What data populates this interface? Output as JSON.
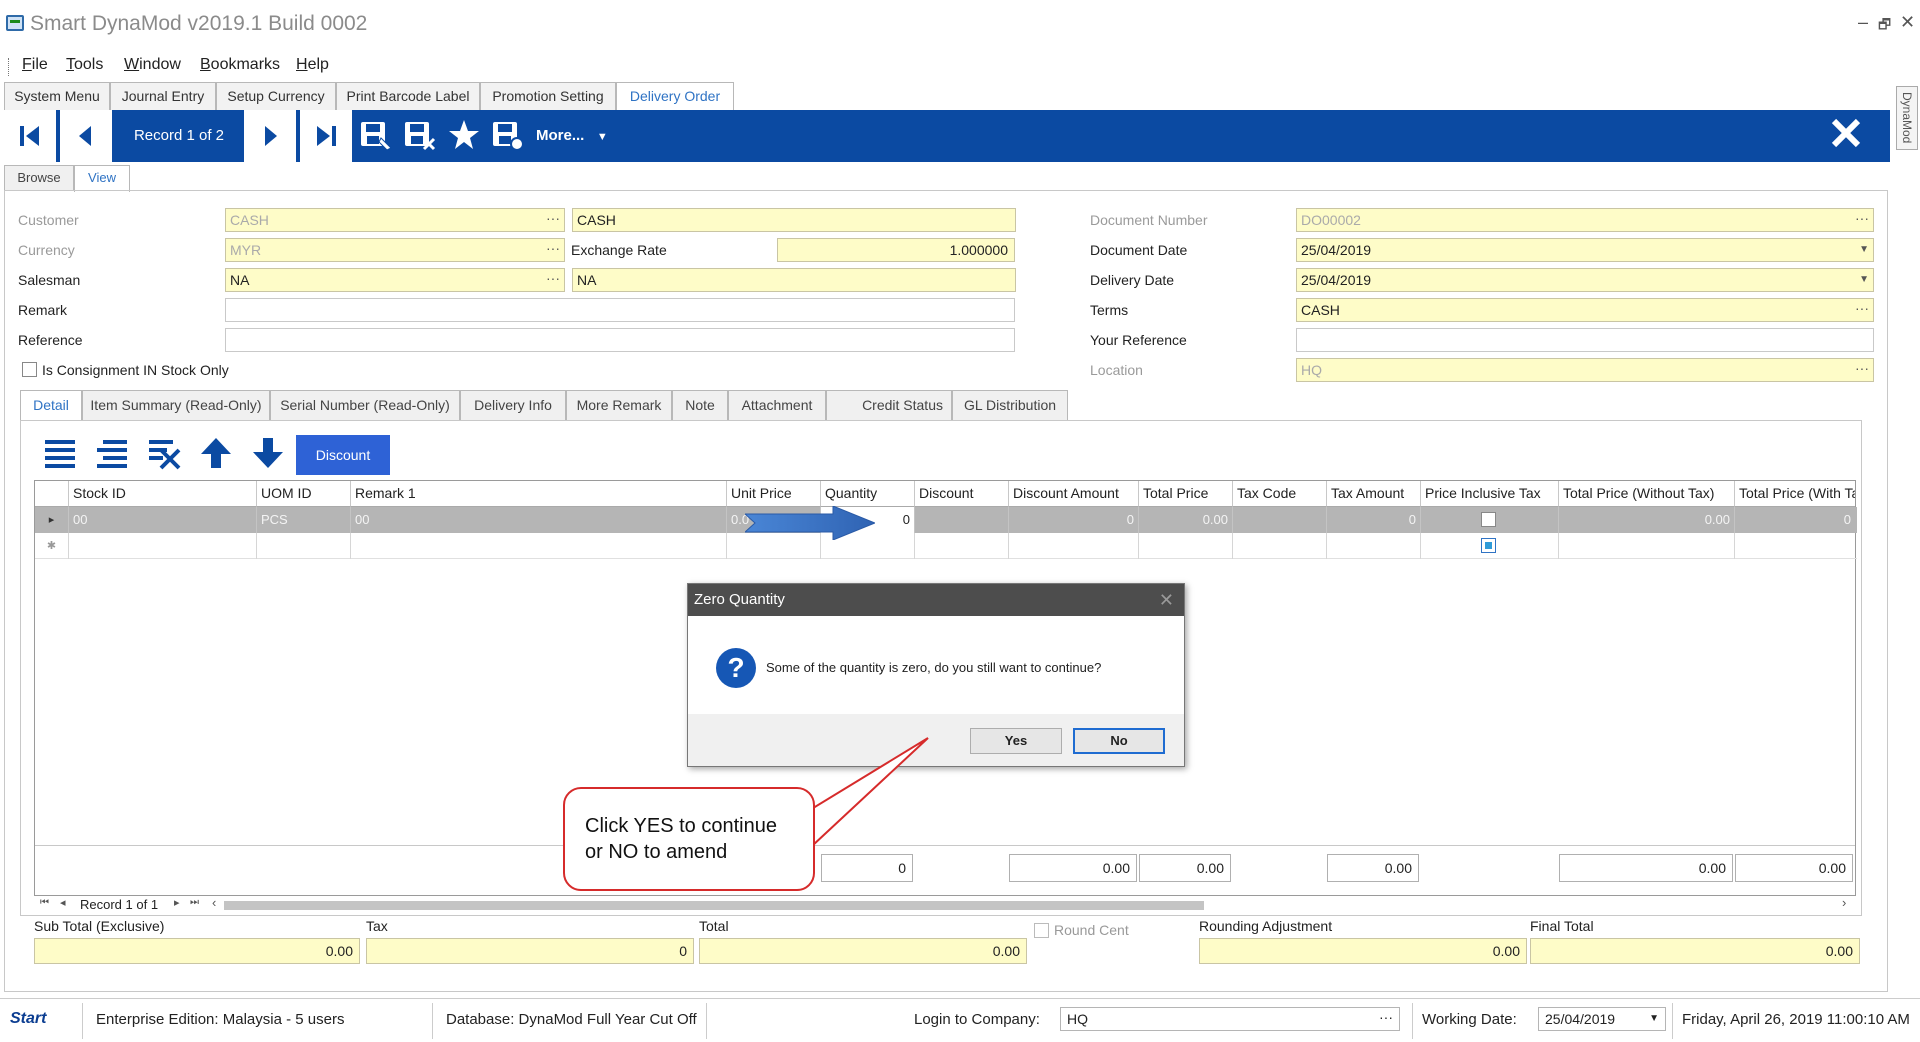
{
  "window": {
    "title": "Smart DynaMod v2019.1 Build 0002",
    "controls": [
      "–",
      "🗗",
      "✕"
    ]
  },
  "menu": [
    {
      "underline": "F",
      "rest": "ile"
    },
    {
      "underline": "T",
      "rest": "ools"
    },
    {
      "underline": "W",
      "rest": "indow"
    },
    {
      "underline": "B",
      "rest": "ookmarks"
    },
    {
      "underline": "H",
      "rest": "elp"
    }
  ],
  "top_tabs": [
    "System Menu",
    "Journal Entry",
    "Setup Currency",
    "Print Barcode Label",
    "Promotion Setting",
    "Delivery Order"
  ],
  "side_tab": "DynaMod",
  "toolbar": {
    "record": "Record 1 of 2",
    "more": "More...",
    "more_caret": "▼"
  },
  "view_tabs": [
    "Browse",
    "View"
  ],
  "form": {
    "customer_label": "Customer",
    "customer_code": "CASH",
    "customer_name": "CASH",
    "currency_label": "Currency",
    "currency_code": "MYR",
    "exchange_rate_label": "Exchange Rate",
    "exchange_rate": "1.000000",
    "salesman_label": "Salesman",
    "salesman_code": "NA",
    "salesman_name": "NA",
    "remark_label": "Remark",
    "remark": "",
    "reference_label": "Reference",
    "reference": "",
    "consignment_label": "Is Consignment IN Stock Only",
    "document_number_label": "Document Number",
    "document_number": "DO00002",
    "document_date_label": "Document Date",
    "document_date": "25/04/2019",
    "delivery_date_label": "Delivery Date",
    "delivery_date": "25/04/2019",
    "terms_label": "Terms",
    "terms": "CASH",
    "your_reference_label": "Your Reference",
    "your_reference": "",
    "location_label": "Location",
    "location": "HQ",
    "dots": "···"
  },
  "detail_tabs": [
    "Detail",
    "Item Summary (Read-Only)",
    "Serial Number (Read-Only)",
    "Delivery Info",
    "More Remark",
    "Note",
    "Attachment",
    "Credit Status",
    "GL Distribution"
  ],
  "detail_toolbar": {
    "discount": "Discount"
  },
  "grid": {
    "columns": [
      "Stock ID",
      "UOM ID",
      "Remark 1",
      "Unit Price",
      "Quantity",
      "Discount",
      "Discount Amount",
      "Total Price",
      "Tax Code",
      "Tax Amount",
      "Price Inclusive Tax",
      "Total Price (Without Tax)",
      "Total Price (With Tax"
    ],
    "row": {
      "indicator": "▸",
      "stock_id": "00",
      "uom": "PCS",
      "remark": "00",
      "unit_price": "0.0",
      "quantity": "0",
      "discount_amount": "0",
      "total_price": "0.00",
      "tax_amount": "0",
      "total_without_tax": "0.00",
      "total_with_tax": "0"
    },
    "new_row_indicator": "✱",
    "totals": {
      "quantity": "0",
      "discount_amount": "0.00",
      "total_price": "0.00",
      "tax_amount": "0.00",
      "total_without_tax": "0.00",
      "total_with_tax": "0.00"
    },
    "navigator": "Record 1 of 1",
    "nav_first": "⏮",
    "nav_prev": "◂",
    "nav_next": "▸",
    "nav_last": "⏭",
    "scroll_left": "‹",
    "scroll_right": "›"
  },
  "bottom_totals": {
    "subtotal_label": "Sub Total (Exclusive)",
    "subtotal": "0.00",
    "tax_label": "Tax",
    "tax": "0",
    "total_label": "Total",
    "total": "0.00",
    "round_cent_label": "Round Cent",
    "rounding_label": "Rounding Adjustment",
    "rounding": "0.00",
    "final_label": "Final Total",
    "final": "0.00"
  },
  "status": {
    "logo": "Start",
    "edition": "Enterprise Edition: Malaysia - 5 users",
    "database": "Database: DynaMod Full Year Cut Off",
    "login_label": "Login to Company:",
    "company": "HQ",
    "working_date_label": "Working Date:",
    "working_date": "25/04/2019",
    "datetime": "Friday, April 26, 2019 11:00:10 AM"
  },
  "dialog": {
    "title": "Zero Quantity",
    "close": "✕",
    "icon": "?",
    "message": "Some of the quantity is zero, do you still want to continue?",
    "yes": "Yes",
    "no": "No"
  },
  "callout": {
    "line1": "Click YES to continue",
    "line2": "or NO to amend"
  },
  "colors": {
    "toolbar_blue": "#0b4aa2",
    "field_yellow": "#fefcc8",
    "active_tab_text": "#2f73c4",
    "discount_button": "#2e62d6",
    "callout_border": "#d62b2b",
    "arrow_blue": "#3c76c9"
  }
}
